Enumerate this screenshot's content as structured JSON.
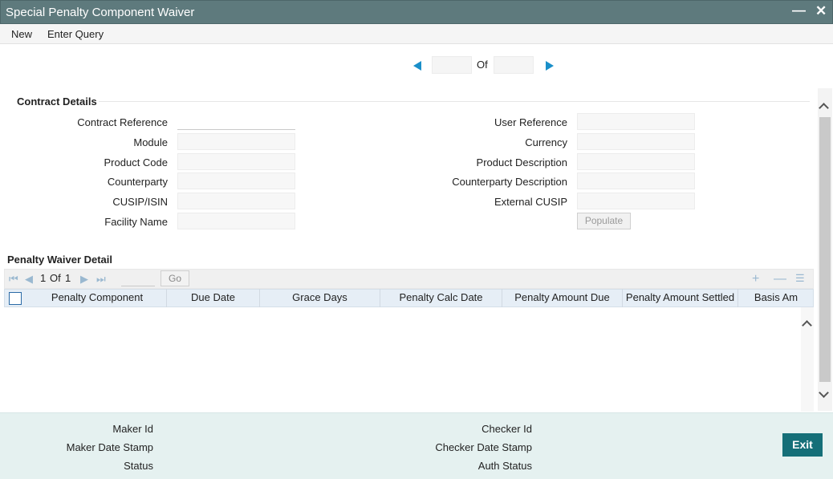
{
  "window": {
    "title": "Special Penalty Component Waiver"
  },
  "menu": {
    "new": "New",
    "enter_query": "Enter Query"
  },
  "pager": {
    "of": "Of",
    "current": "",
    "total": ""
  },
  "contract": {
    "title": "Contract Details",
    "contract_reference": "Contract Reference",
    "module": "Module",
    "product_code": "Product Code",
    "counterparty": "Counterparty",
    "cusip_isin": "CUSIP/ISIN",
    "facility_name": "Facility Name",
    "user_reference": "User Reference",
    "currency": "Currency",
    "product_description": "Product Description",
    "counterparty_description": "Counterparty Description",
    "external_cusip": "External CUSIP",
    "populate": "Populate"
  },
  "waiver": {
    "title": "Penalty Waiver Detail",
    "page": "1",
    "of": "Of",
    "total": "1",
    "go": "Go",
    "columns": [
      "Penalty Component",
      "Due Date",
      "Grace Days",
      "Penalty Calc Date",
      "Penalty Amount Due",
      "Penalty Amount Settled",
      "Basis Am"
    ],
    "rows": []
  },
  "footer": {
    "maker_id": "Maker Id",
    "maker_date_stamp": "Maker Date Stamp",
    "status": "Status",
    "checker_id": "Checker Id",
    "checker_date_stamp": "Checker Date Stamp",
    "auth_status": "Auth Status",
    "exit": "Exit"
  },
  "colors": {
    "titlebar": "#5e7a7d",
    "accent": "#1a8fc9",
    "exit": "#156f78",
    "footer": "#e5f1f0"
  }
}
